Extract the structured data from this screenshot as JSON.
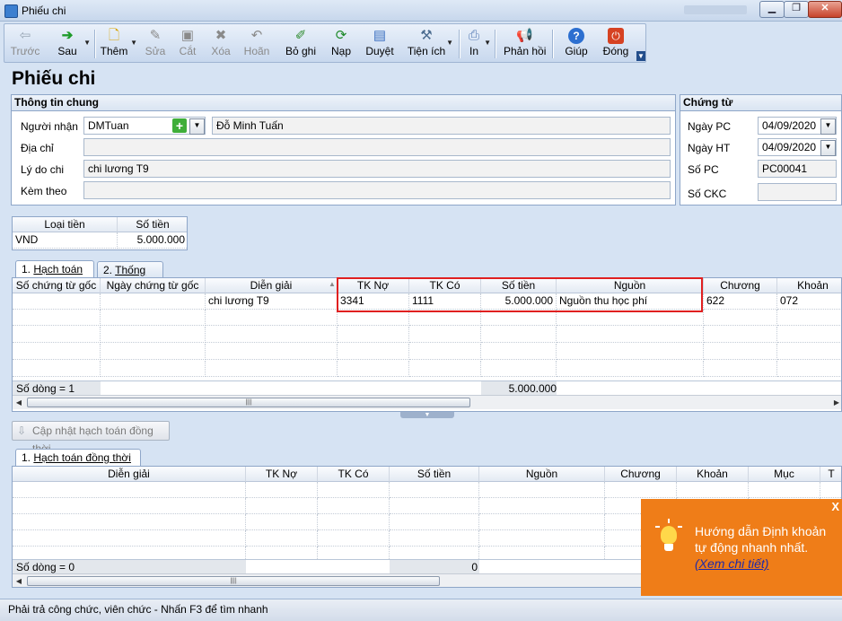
{
  "window": {
    "title": "Phiếu chi"
  },
  "toolbar": {
    "back": "Trước",
    "next": "Sau",
    "add": "Thêm",
    "edit": "Sửa",
    "delete": "Xóa",
    "cut": "Cắt",
    "undo": "Hoãn",
    "post": "Bỏ ghi",
    "submit": "Nạp",
    "approve": "Duyệt",
    "tools": "Tiện ích",
    "print": "In",
    "feedback": "Phản hồi",
    "help": "Giúp",
    "close": "Đóng"
  },
  "page": {
    "title": "Phiếu chi"
  },
  "general": {
    "header": "Thông tin chung",
    "recipient_label": "Người nhận",
    "recipient_code": "DMTuan",
    "recipient_name": "Đỗ Minh Tuấn",
    "address_label": "Địa chỉ",
    "address": "",
    "reason_label": "Lý do chi",
    "reason": "chi lương T9",
    "attach_label": "Kèm theo",
    "attach": ""
  },
  "voucher": {
    "header": "Chứng từ",
    "date_pc_label": "Ngày PC",
    "date_pc": "04/09/2020",
    "date_ht_label": "Ngày HT",
    "date_ht": "04/09/2020",
    "no_label": "Số PC",
    "no": "PC00041",
    "ckc_label": "Số CKC",
    "ckc": ""
  },
  "currency": {
    "type_label": "Loại tiền",
    "amount_label": "Số tiền",
    "type": "VND",
    "amount": "5.000.000"
  },
  "tabs": {
    "accounting": "Hạch toán",
    "accounting_no": "1.",
    "stats": "Thống kê",
    "stats_no": "2."
  },
  "grid1": {
    "columns": [
      "Số chứng từ gốc",
      "Ngày chứng từ gốc",
      "Diễn giải",
      "TK Nợ",
      "TK Có",
      "Số tiền",
      "Nguồn",
      "Chương",
      "Khoản"
    ],
    "row": {
      "desc": "chi lương T9",
      "debit": "3341",
      "credit": "1111",
      "amount": "5.000.000",
      "source": "Nguồn thu học phí",
      "chapter": "622",
      "item": "072"
    },
    "footer_count": "Số dòng = 1",
    "footer_amount": "5.000.000"
  },
  "update_button": "Cập nhật hạch toán đồng thời",
  "tab2": {
    "label": "Hạch toán đồng thời",
    "no": "1."
  },
  "grid2": {
    "columns": [
      "Diễn giải",
      "TK Nợ",
      "TK Có",
      "Số tiền",
      "Nguồn",
      "Chương",
      "Khoản",
      "Mục",
      "T"
    ],
    "footer_count": "Số dòng = 0",
    "footer_amount": "0"
  },
  "status": "Phải trả công chức, viên chức - Nhấn F3 để tìm nhanh",
  "popup": {
    "line1": "Hướng dẫn Định khoản",
    "line2": "tự động nhanh nhất.",
    "link": "(Xem chi tiết)",
    "close": "X"
  },
  "colors": {
    "popup": "#ef7d18",
    "highlight": "#e02020"
  }
}
